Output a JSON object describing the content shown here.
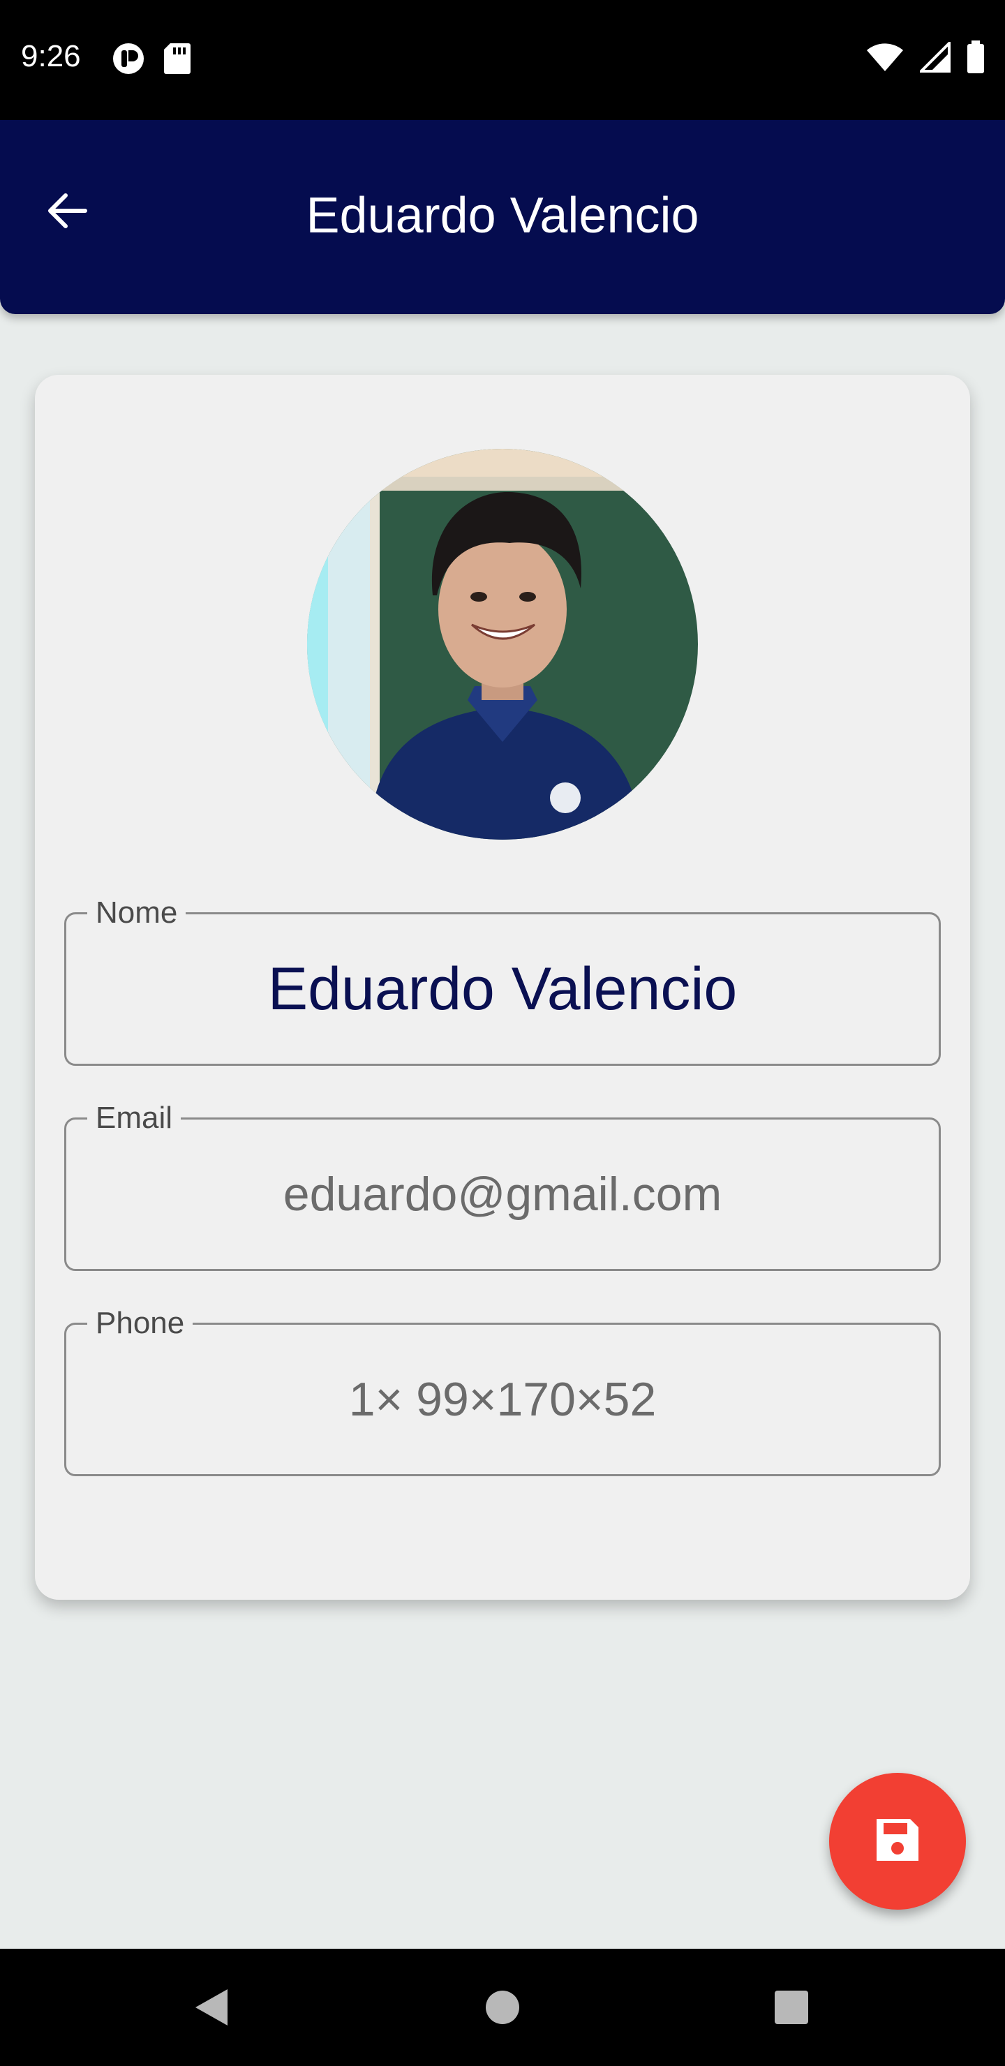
{
  "status_bar": {
    "time": "9:26",
    "left_icons": [
      "notification-app-icon",
      "sd-card-icon"
    ],
    "right_icons": [
      "wifi-icon",
      "signal-icon",
      "battery-icon"
    ]
  },
  "app_bar": {
    "title": "Eduardo Valencio",
    "back_icon": "arrow-back-icon"
  },
  "profile": {
    "avatar": "profile-photo"
  },
  "fields": {
    "name": {
      "label": "Nome",
      "value": "Eduardo Valencio"
    },
    "email": {
      "label": "Email",
      "value": "eduardo@gmail.com"
    },
    "phone": {
      "label": "Phone",
      "value": "1× 99×170×52"
    }
  },
  "fab": {
    "icon": "save-icon",
    "color": "#f23f33"
  },
  "nav_bar": {
    "icons": [
      "back-triangle-icon",
      "home-circle-icon",
      "recents-square-icon"
    ]
  },
  "colors": {
    "app_bar": "#050c4f",
    "background": "#e8eceb",
    "card": "#f0f0f0",
    "name_text": "#0a1052"
  }
}
